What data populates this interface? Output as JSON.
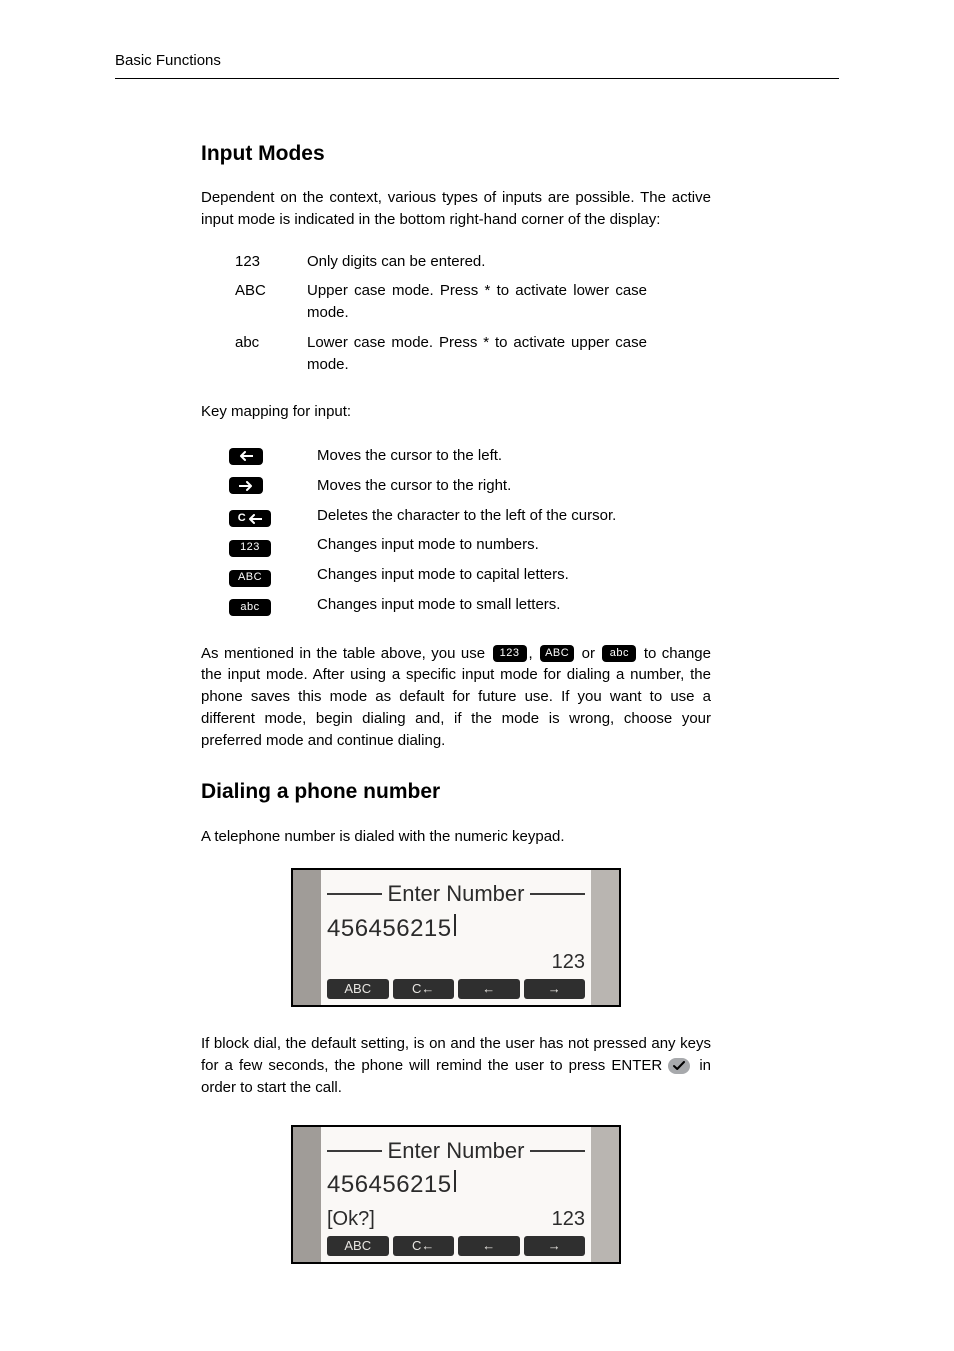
{
  "header": {
    "section": "Basic Functions"
  },
  "section1": {
    "heading": "Input Modes",
    "intro": "Dependent on the context, various types of inputs are possible. The active input mode is indicated in the bottom right-hand corner of the display:",
    "modes": [
      {
        "key": "123",
        "desc": "Only digits can be entered."
      },
      {
        "key": "ABC",
        "desc": "Upper case mode. Press * to activate lower case mode."
      },
      {
        "key": "abc",
        "desc": "Lower case mode. Press * to activate upper case mode."
      }
    ],
    "keymap_label": "Key mapping for input:",
    "keys": [
      {
        "icon": "arrow-left",
        "desc": "Moves the cursor to the left."
      },
      {
        "icon": "arrow-right",
        "desc": "Moves the cursor to the right."
      },
      {
        "icon": "c-back",
        "desc": "Deletes the character to the left of the cursor."
      },
      {
        "icon": "123",
        "desc": "Changes input mode to numbers."
      },
      {
        "icon": "ABC",
        "desc": "Changes input mode to capital letters."
      },
      {
        "icon": "abc",
        "desc": "Changes input mode to small letters."
      }
    ],
    "closing_pre": "As mentioned in the table above, you use ",
    "closing_mid1": ", ",
    "closing_mid2": " or ",
    "closing_post": " to change the input mode. After using a specific input mode for dialing a number, the phone saves this mode as default for future use. If you want to use a different mode, begin dialing and, if the mode is wrong, choose your preferred mode and continue dialing.",
    "chips": {
      "num": "123",
      "upper": "ABC",
      "lower": "abc"
    }
  },
  "section2": {
    "heading": "Dialing a phone number",
    "intro": "A telephone number is dialed with the numeric keypad.",
    "display1": {
      "title": "Enter Number",
      "number": "456456215",
      "mode": "123",
      "softkeys": [
        "ABC",
        "C←",
        "←",
        "→"
      ]
    },
    "para2_pre": "If block dial, the default setting, is on and the user has not pressed any keys for a few seconds, the phone will remind the user to press ENTER ",
    "para2_post": " in order to start the call.",
    "display2": {
      "title": "Enter Number",
      "number": "456456215",
      "prompt": "[Ok?]",
      "mode": "123",
      "softkeys": [
        "ABC",
        "C←",
        "←",
        "→"
      ]
    }
  }
}
